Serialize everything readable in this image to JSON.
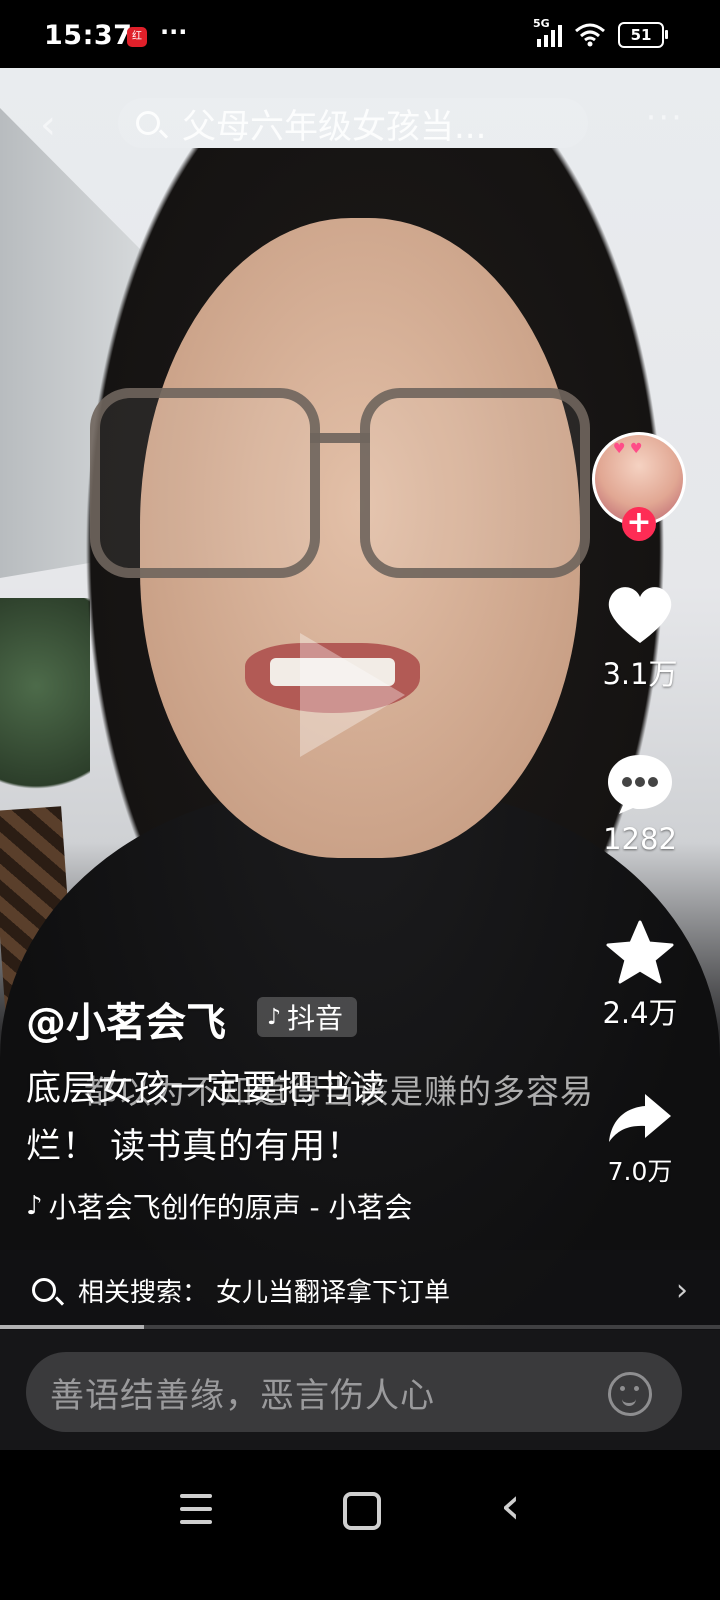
{
  "status_bar": {
    "time": "15:37",
    "app_icon_text": "红",
    "more": "···",
    "network": "5G",
    "battery": "51"
  },
  "top": {
    "search_query": "父母六年级女孩当...",
    "back_icon": "chevron-left-icon",
    "more_icon": "more-icon"
  },
  "actions": {
    "like_count": "3.1万",
    "comment_count": "1282",
    "favorite_count": "2.4万",
    "share_count": "7.0万"
  },
  "caption": {
    "author": "@小茗会飞",
    "platform_tag": "抖音",
    "description_line1": "底层女孩一定要把书读",
    "description_line2": "烂！ 读书真的有用！",
    "subtitle": "都以为不知道得当该是赚的多容易",
    "music": "小茗会飞创作的原声 - 小茗会"
  },
  "related_search": {
    "label": "相关搜索：",
    "term": "女儿当翻译拿下订单"
  },
  "progress": {
    "fraction": 0.2
  },
  "comment_bar": {
    "placeholder": "善语结善缘，恶言伤人心"
  },
  "colors": {
    "accent": "#fe2c55",
    "input_bg": "#3a3a3c"
  }
}
